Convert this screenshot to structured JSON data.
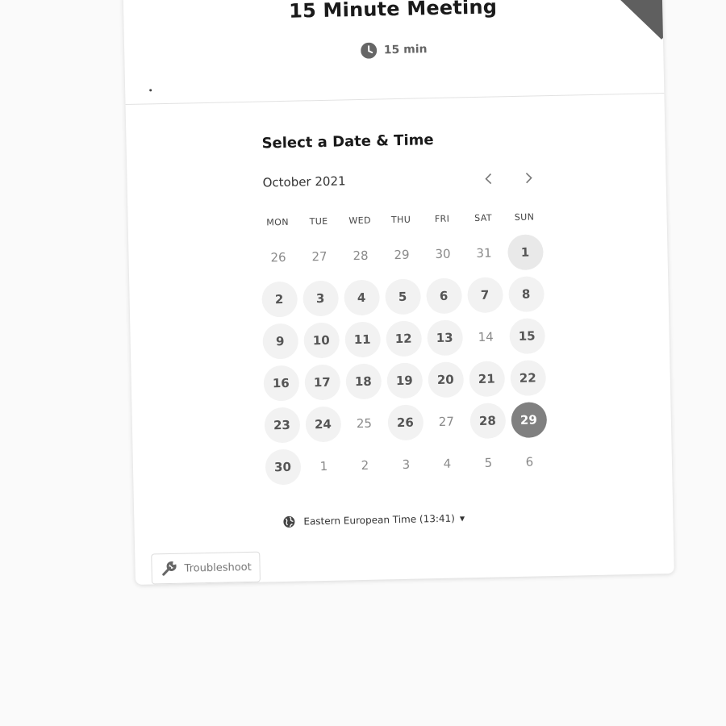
{
  "event": {
    "title": "15 Minute Meeting",
    "duration": "15 min",
    "icon": "clock-icon"
  },
  "scheduler": {
    "heading": "Select a Date & Time",
    "month": "October 2021",
    "prev_icon": "chevron-left-icon",
    "next_icon": "chevron-right-icon",
    "weekdays": [
      "MON",
      "TUE",
      "WED",
      "THU",
      "FRI",
      "SAT",
      "SUN"
    ],
    "days": [
      {
        "label": "26",
        "state": "other-month"
      },
      {
        "label": "27",
        "state": "other-month"
      },
      {
        "label": "28",
        "state": "other-month"
      },
      {
        "label": "29",
        "state": "other-month"
      },
      {
        "label": "30",
        "state": "other-month"
      },
      {
        "label": "31",
        "state": "other-month"
      },
      {
        "label": "1",
        "state": "available"
      },
      {
        "label": "2",
        "state": "available"
      },
      {
        "label": "3",
        "state": "available"
      },
      {
        "label": "4",
        "state": "available"
      },
      {
        "label": "5",
        "state": "available"
      },
      {
        "label": "6",
        "state": "available"
      },
      {
        "label": "7",
        "state": "available"
      },
      {
        "label": "8",
        "state": "available"
      },
      {
        "label": "9",
        "state": "available"
      },
      {
        "label": "10",
        "state": "available"
      },
      {
        "label": "11",
        "state": "available"
      },
      {
        "label": "12",
        "state": "available"
      },
      {
        "label": "13",
        "state": "available"
      },
      {
        "label": "14",
        "state": "unavailable"
      },
      {
        "label": "15",
        "state": "available"
      },
      {
        "label": "16",
        "state": "available"
      },
      {
        "label": "17",
        "state": "available"
      },
      {
        "label": "18",
        "state": "available"
      },
      {
        "label": "19",
        "state": "available"
      },
      {
        "label": "20",
        "state": "available"
      },
      {
        "label": "21",
        "state": "available"
      },
      {
        "label": "22",
        "state": "available"
      },
      {
        "label": "23",
        "state": "available"
      },
      {
        "label": "24",
        "state": "available"
      },
      {
        "label": "25",
        "state": "unavailable"
      },
      {
        "label": "26",
        "state": "available"
      },
      {
        "label": "27",
        "state": "unavailable"
      },
      {
        "label": "28",
        "state": "available"
      },
      {
        "label": "29",
        "state": "selected"
      },
      {
        "label": "30",
        "state": "available"
      },
      {
        "label": "1",
        "state": "other-month"
      },
      {
        "label": "2",
        "state": "other-month"
      },
      {
        "label": "3",
        "state": "other-month"
      },
      {
        "label": "4",
        "state": "other-month"
      },
      {
        "label": "5",
        "state": "other-month"
      },
      {
        "label": "6",
        "state": "other-month"
      }
    ],
    "timezone": "Eastern European Time (13:41)",
    "timezone_icon": "globe-icon"
  },
  "footer": {
    "troubleshoot_label": "Troubleshoot",
    "troubleshoot_icon": "wrench-icon"
  },
  "colors": {
    "selected_day": "#808080",
    "available_day_bg": "#f2f2f2",
    "corner_ribbon": "#5f5f5f"
  }
}
